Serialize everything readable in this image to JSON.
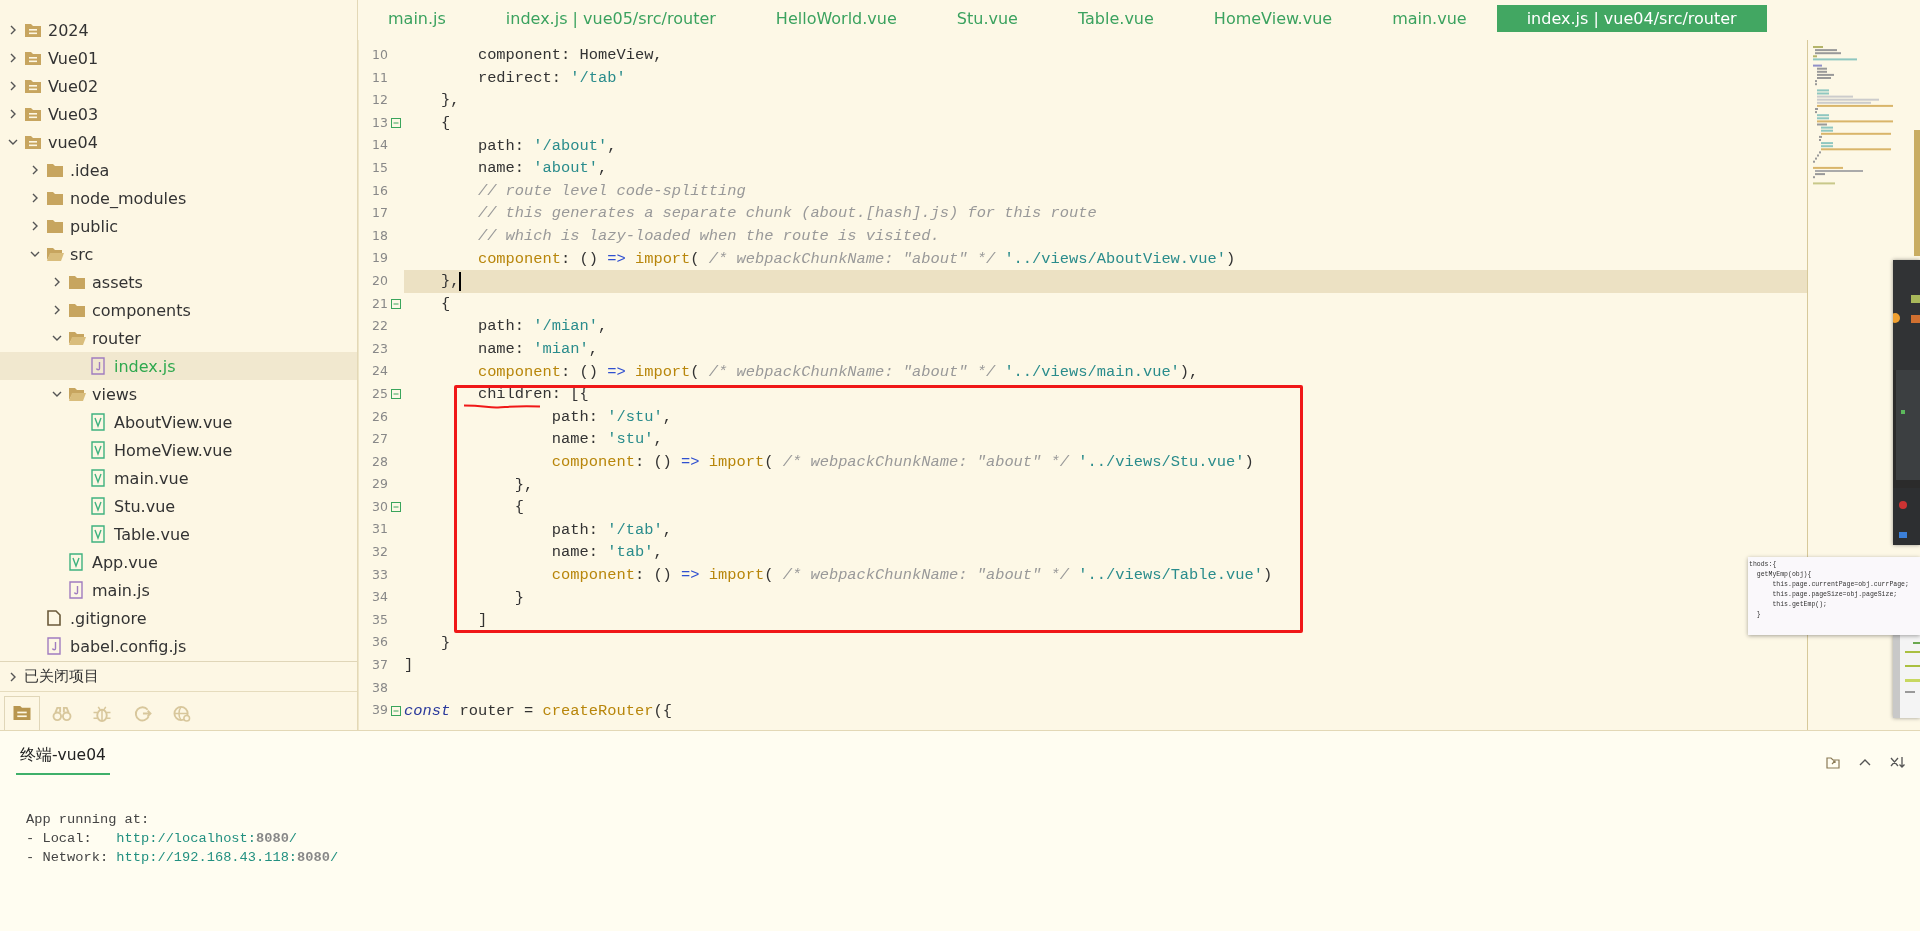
{
  "sidebar": {
    "tree": [
      {
        "label": "2024",
        "kind": "project",
        "expanded": false,
        "selected": false
      },
      {
        "label": "Vue01",
        "kind": "project",
        "expanded": false,
        "selected": false
      },
      {
        "label": "Vue02",
        "kind": "project",
        "expanded": false,
        "selected": false
      },
      {
        "label": "Vue03",
        "kind": "project",
        "expanded": false,
        "selected": false
      },
      {
        "label": "vue04",
        "kind": "project",
        "expanded": true,
        "selected": false,
        "children": [
          {
            "label": ".idea",
            "kind": "folder",
            "expanded": false,
            "selected": false
          },
          {
            "label": "node_modules",
            "kind": "folder",
            "expanded": false,
            "selected": false
          },
          {
            "label": "public",
            "kind": "folder",
            "expanded": false,
            "selected": false
          },
          {
            "label": "src",
            "kind": "folder",
            "expanded": true,
            "selected": false,
            "children": [
              {
                "label": "assets",
                "kind": "folder",
                "expanded": false,
                "selected": false
              },
              {
                "label": "components",
                "kind": "folder",
                "expanded": false,
                "selected": false
              },
              {
                "label": "router",
                "kind": "folder",
                "expanded": true,
                "selected": false,
                "children": [
                  {
                    "label": "index.js",
                    "kind": "js",
                    "selected": true
                  }
                ]
              },
              {
                "label": "views",
                "kind": "folder",
                "expanded": true,
                "selected": false,
                "children": [
                  {
                    "label": "AboutView.vue",
                    "kind": "vue",
                    "selected": false
                  },
                  {
                    "label": "HomeView.vue",
                    "kind": "vue",
                    "selected": false
                  },
                  {
                    "label": "main.vue",
                    "kind": "vue",
                    "selected": false
                  },
                  {
                    "label": "Stu.vue",
                    "kind": "vue",
                    "selected": false
                  },
                  {
                    "label": "Table.vue",
                    "kind": "vue",
                    "selected": false
                  }
                ]
              },
              {
                "label": "App.vue",
                "kind": "vue",
                "selected": false
              },
              {
                "label": "main.js",
                "kind": "js",
                "selected": false
              }
            ]
          },
          {
            "label": ".gitignore",
            "kind": "file",
            "selected": false
          },
          {
            "label": "babel.config.js",
            "kind": "js",
            "selected": false
          }
        ]
      }
    ],
    "closed_projects": {
      "label": "已关闭项目",
      "expanded": false
    },
    "tools": [
      {
        "selected": true
      },
      {
        "selected": false
      },
      {
        "selected": false
      },
      {
        "selected": false
      },
      {
        "selected": false
      }
    ]
  },
  "tabs": [
    {
      "label": "main.js",
      "selected": false
    },
    {
      "label": "index.js | vue05/src/router",
      "selected": false
    },
    {
      "label": "HelloWorld.vue",
      "selected": false
    },
    {
      "label": "Stu.vue",
      "selected": false
    },
    {
      "label": "Table.vue",
      "selected": false
    },
    {
      "label": "HomeView.vue",
      "selected": false
    },
    {
      "label": "main.vue",
      "selected": false
    },
    {
      "label": "index.js | vue04/src/router",
      "selected": true
    }
  ],
  "editor": {
    "lines": [
      {
        "number": "10",
        "foldable": false,
        "current": false,
        "segments": [
          {
            "kind": "plain",
            "text": "        component: HomeView,"
          }
        ]
      },
      {
        "number": "11",
        "foldable": false,
        "current": false,
        "segments": [
          {
            "kind": "plain",
            "text": "        redirect: "
          },
          {
            "kind": "string",
            "text": "'/tab'"
          }
        ]
      },
      {
        "number": "12",
        "foldable": false,
        "current": false,
        "segments": [
          {
            "kind": "plain",
            "text": "    },"
          }
        ]
      },
      {
        "number": "13",
        "foldable": true,
        "current": false,
        "segments": [
          {
            "kind": "plain",
            "text": "    {"
          }
        ]
      },
      {
        "number": "14",
        "foldable": false,
        "current": false,
        "segments": [
          {
            "kind": "plain",
            "text": "        path: "
          },
          {
            "kind": "string",
            "text": "'/about'"
          },
          {
            "kind": "plain",
            "text": ","
          }
        ]
      },
      {
        "number": "15",
        "foldable": false,
        "current": false,
        "segments": [
          {
            "kind": "plain",
            "text": "        name: "
          },
          {
            "kind": "string",
            "text": "'about'"
          },
          {
            "kind": "plain",
            "text": ","
          }
        ]
      },
      {
        "number": "16",
        "foldable": false,
        "current": false,
        "segments": [
          {
            "kind": "comment",
            "text": "        // route level code-splitting"
          }
        ]
      },
      {
        "number": "17",
        "foldable": false,
        "current": false,
        "segments": [
          {
            "kind": "comment",
            "text": "        // this generates a separate chunk (about.[hash].js) for this route"
          }
        ]
      },
      {
        "number": "18",
        "foldable": false,
        "current": false,
        "segments": [
          {
            "kind": "comment",
            "text": "        // which is lazy-loaded when the route is visited."
          }
        ]
      },
      {
        "number": "19",
        "foldable": false,
        "current": false,
        "segments": [
          {
            "kind": "keyword",
            "text": "        component"
          },
          {
            "kind": "plain",
            "text": ": () "
          },
          {
            "kind": "operator",
            "text": "=>"
          },
          {
            "kind": "keyword",
            "text": " import"
          },
          {
            "kind": "plain",
            "text": "( "
          },
          {
            "kind": "comment",
            "text": "/* webpackChunkName: \"about\" */"
          },
          {
            "kind": "string",
            "text": " '../views/AboutView.vue'"
          },
          {
            "kind": "plain",
            "text": ")"
          }
        ]
      },
      {
        "number": "20",
        "foldable": false,
        "current": true,
        "segments": [
          {
            "kind": "plain",
            "text": "    },"
          }
        ]
      },
      {
        "number": "21",
        "foldable": true,
        "current": false,
        "segments": [
          {
            "kind": "plain",
            "text": "    {"
          }
        ]
      },
      {
        "number": "22",
        "foldable": false,
        "current": false,
        "segments": [
          {
            "kind": "plain",
            "text": "        path: "
          },
          {
            "kind": "string",
            "text": "'/mian'"
          },
          {
            "kind": "plain",
            "text": ","
          }
        ]
      },
      {
        "number": "23",
        "foldable": false,
        "current": false,
        "segments": [
          {
            "kind": "plain",
            "text": "        name: "
          },
          {
            "kind": "string",
            "text": "'mian'"
          },
          {
            "kind": "plain",
            "text": ","
          }
        ]
      },
      {
        "number": "24",
        "foldable": false,
        "current": false,
        "segments": [
          {
            "kind": "keyword",
            "text": "        component"
          },
          {
            "kind": "plain",
            "text": ": () "
          },
          {
            "kind": "operator",
            "text": "=>"
          },
          {
            "kind": "keyword",
            "text": " import"
          },
          {
            "kind": "plain",
            "text": "( "
          },
          {
            "kind": "comment",
            "text": "/* webpackChunkName: \"about\" */"
          },
          {
            "kind": "string",
            "text": " '../views/main.vue'"
          },
          {
            "kind": "plain",
            "text": "),"
          }
        ]
      },
      {
        "number": "25",
        "foldable": true,
        "current": false,
        "segments": [
          {
            "kind": "plain",
            "text": "        children: [{"
          }
        ]
      },
      {
        "number": "26",
        "foldable": false,
        "current": false,
        "segments": [
          {
            "kind": "plain",
            "text": "                path: "
          },
          {
            "kind": "string",
            "text": "'/stu'"
          },
          {
            "kind": "plain",
            "text": ","
          }
        ]
      },
      {
        "number": "27",
        "foldable": false,
        "current": false,
        "segments": [
          {
            "kind": "plain",
            "text": "                name: "
          },
          {
            "kind": "string",
            "text": "'stu'"
          },
          {
            "kind": "plain",
            "text": ","
          }
        ]
      },
      {
        "number": "28",
        "foldable": false,
        "current": false,
        "segments": [
          {
            "kind": "keyword",
            "text": "                component"
          },
          {
            "kind": "plain",
            "text": ": () "
          },
          {
            "kind": "operator",
            "text": "=>"
          },
          {
            "kind": "keyword",
            "text": " import"
          },
          {
            "kind": "plain",
            "text": "( "
          },
          {
            "kind": "comment",
            "text": "/* webpackChunkName: \"about\" */"
          },
          {
            "kind": "string",
            "text": " '../views/Stu.vue'"
          },
          {
            "kind": "plain",
            "text": ")"
          }
        ]
      },
      {
        "number": "29",
        "foldable": false,
        "current": false,
        "segments": [
          {
            "kind": "plain",
            "text": "            },"
          }
        ]
      },
      {
        "number": "30",
        "foldable": true,
        "current": false,
        "segments": [
          {
            "kind": "plain",
            "text": "            {"
          }
        ]
      },
      {
        "number": "31",
        "foldable": false,
        "current": false,
        "segments": [
          {
            "kind": "plain",
            "text": "                path: "
          },
          {
            "kind": "string",
            "text": "'/tab'"
          },
          {
            "kind": "plain",
            "text": ","
          }
        ]
      },
      {
        "number": "32",
        "foldable": false,
        "current": false,
        "segments": [
          {
            "kind": "plain",
            "text": "                name: "
          },
          {
            "kind": "string",
            "text": "'tab'"
          },
          {
            "kind": "plain",
            "text": ","
          }
        ]
      },
      {
        "number": "33",
        "foldable": false,
        "current": false,
        "segments": [
          {
            "kind": "keyword",
            "text": "                component"
          },
          {
            "kind": "plain",
            "text": ": () "
          },
          {
            "kind": "operator",
            "text": "=>"
          },
          {
            "kind": "keyword",
            "text": " import"
          },
          {
            "kind": "plain",
            "text": "( "
          },
          {
            "kind": "comment",
            "text": "/* webpackChunkName: \"about\" */"
          },
          {
            "kind": "string",
            "text": " '../views/Table.vue'"
          },
          {
            "kind": "plain",
            "text": ")"
          }
        ]
      },
      {
        "number": "34",
        "foldable": false,
        "current": false,
        "segments": [
          {
            "kind": "plain",
            "text": "            }"
          }
        ]
      },
      {
        "number": "35",
        "foldable": false,
        "current": false,
        "segments": [
          {
            "kind": "plain",
            "text": "        ]"
          }
        ]
      },
      {
        "number": "36",
        "foldable": false,
        "current": false,
        "segments": [
          {
            "kind": "plain",
            "text": "    }"
          }
        ]
      },
      {
        "number": "37",
        "foldable": false,
        "current": false,
        "segments": [
          {
            "kind": "plain",
            "text": "]"
          }
        ]
      },
      {
        "number": "38",
        "foldable": false,
        "current": false
      },
      {
        "number": "39",
        "foldable": true,
        "current": false,
        "segments": [
          {
            "kind": "declaration",
            "text": "const"
          },
          {
            "kind": "plain",
            "text": " router = "
          },
          {
            "kind": "keyword",
            "text": "createRouter"
          },
          {
            "kind": "plain",
            "text": "({"
          }
        ]
      }
    ]
  },
  "snippet": {
    "lines": [
      "thods:{",
      "  getMyEmp(obj){",
      "      this.page.currentPage=obj.currPage;",
      "      this.page.pageSize=obj.pageSize;",
      "      this.getEmp();",
      "  }"
    ]
  },
  "terminal": {
    "tab": {
      "label": "终端-vue04",
      "selected": true
    },
    "output": [
      {
        "label": "App running at:"
      },
      {
        "label": "- Local:   ",
        "url": "http://localhost:**8080**/"
      },
      {
        "label": "- Network: ",
        "url": "http://192.168.43.118:**8080**/"
      }
    ]
  }
}
